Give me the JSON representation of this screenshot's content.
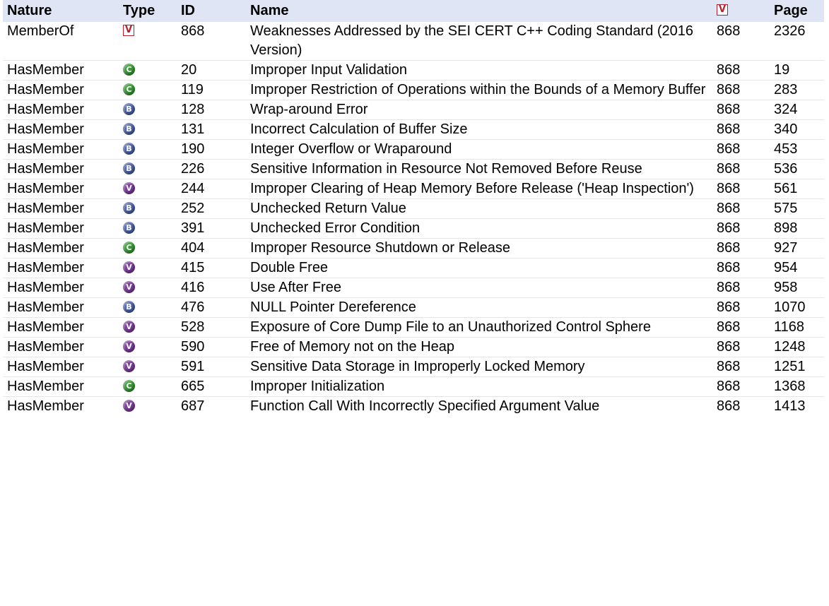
{
  "colors": {
    "header_bg": "#dfe5f5",
    "row_divider": "#e2e6f3",
    "view_icon_red": "#b3232f",
    "class_green": "#3d9a3a",
    "base_blue": "#4f65a8",
    "variant_purple": "#7e3f9e"
  },
  "header": {
    "nature": "Nature",
    "type": "Type",
    "id": "ID",
    "name": "Name",
    "view_icon": "V",
    "page": "Page"
  },
  "rows": [
    {
      "nature": "MemberOf",
      "type_icon": "view-icon",
      "type_letter": "V",
      "id": "868",
      "name": "Weaknesses Addressed by the SEI CERT C++ Coding Standard (2016 Version)",
      "view": "868",
      "page": "2326"
    },
    {
      "nature": "HasMember",
      "type_icon": "class-icon",
      "type_letter": "C",
      "id": "20",
      "name": "Improper Input Validation",
      "view": "868",
      "page": "19"
    },
    {
      "nature": "HasMember",
      "type_icon": "class-icon",
      "type_letter": "C",
      "id": "119",
      "name": "Improper Restriction of Operations within the Bounds of a Memory Buffer",
      "view": "868",
      "page": "283"
    },
    {
      "nature": "HasMember",
      "type_icon": "base-icon",
      "type_letter": "B",
      "id": "128",
      "name": "Wrap-around Error",
      "view": "868",
      "page": "324"
    },
    {
      "nature": "HasMember",
      "type_icon": "base-icon",
      "type_letter": "B",
      "id": "131",
      "name": "Incorrect Calculation of Buffer Size",
      "view": "868",
      "page": "340"
    },
    {
      "nature": "HasMember",
      "type_icon": "base-icon",
      "type_letter": "B",
      "id": "190",
      "name": "Integer Overflow or Wraparound",
      "view": "868",
      "page": "453"
    },
    {
      "nature": "HasMember",
      "type_icon": "base-icon",
      "type_letter": "B",
      "id": "226",
      "name": "Sensitive Information in Resource Not Removed Before Reuse",
      "view": "868",
      "page": "536"
    },
    {
      "nature": "HasMember",
      "type_icon": "variant-icon",
      "type_letter": "V",
      "id": "244",
      "name": "Improper Clearing of Heap Memory Before Release ('Heap Inspection')",
      "view": "868",
      "page": "561"
    },
    {
      "nature": "HasMember",
      "type_icon": "base-icon",
      "type_letter": "B",
      "id": "252",
      "name": "Unchecked Return Value",
      "view": "868",
      "page": "575"
    },
    {
      "nature": "HasMember",
      "type_icon": "base-icon",
      "type_letter": "B",
      "id": "391",
      "name": "Unchecked Error Condition",
      "view": "868",
      "page": "898"
    },
    {
      "nature": "HasMember",
      "type_icon": "class-icon",
      "type_letter": "C",
      "id": "404",
      "name": "Improper Resource Shutdown or Release",
      "view": "868",
      "page": "927"
    },
    {
      "nature": "HasMember",
      "type_icon": "variant-icon",
      "type_letter": "V",
      "id": "415",
      "name": "Double Free",
      "view": "868",
      "page": "954"
    },
    {
      "nature": "HasMember",
      "type_icon": "variant-icon",
      "type_letter": "V",
      "id": "416",
      "name": "Use After Free",
      "view": "868",
      "page": "958"
    },
    {
      "nature": "HasMember",
      "type_icon": "base-icon",
      "type_letter": "B",
      "id": "476",
      "name": "NULL Pointer Dereference",
      "view": "868",
      "page": "1070"
    },
    {
      "nature": "HasMember",
      "type_icon": "variant-icon",
      "type_letter": "V",
      "id": "528",
      "name": "Exposure of Core Dump File to an Unauthorized Control Sphere",
      "view": "868",
      "page": "1168"
    },
    {
      "nature": "HasMember",
      "type_icon": "variant-icon",
      "type_letter": "V",
      "id": "590",
      "name": "Free of Memory not on the Heap",
      "view": "868",
      "page": "1248"
    },
    {
      "nature": "HasMember",
      "type_icon": "variant-icon",
      "type_letter": "V",
      "id": "591",
      "name": "Sensitive Data Storage in Improperly Locked Memory",
      "view": "868",
      "page": "1251"
    },
    {
      "nature": "HasMember",
      "type_icon": "class-icon",
      "type_letter": "C",
      "id": "665",
      "name": "Improper Initialization",
      "view": "868",
      "page": "1368"
    },
    {
      "nature": "HasMember",
      "type_icon": "variant-icon",
      "type_letter": "V",
      "id": "687",
      "name": "Function Call With Incorrectly Specified Argument Value",
      "view": "868",
      "page": "1413"
    }
  ]
}
